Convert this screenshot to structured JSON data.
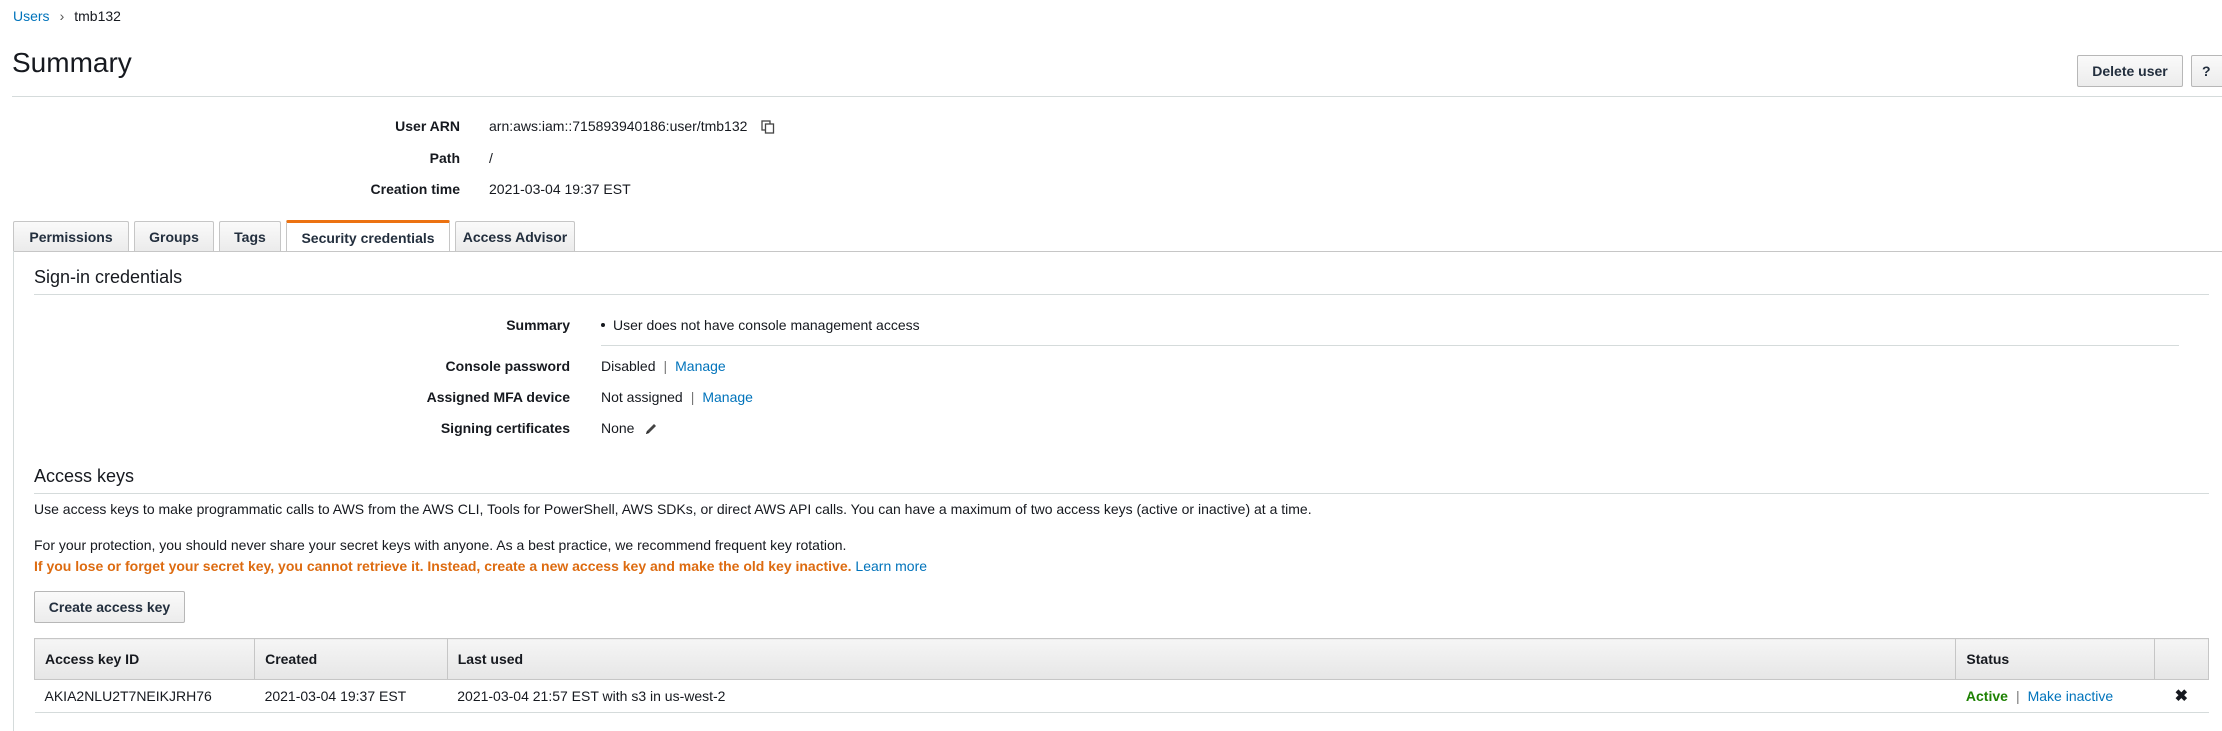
{
  "breadcrumb": {
    "root": "Users",
    "current": "tmb132"
  },
  "header": {
    "title": "Summary",
    "delete_label": "Delete user",
    "help_label": "?"
  },
  "summary": {
    "arn_label": "User ARN",
    "arn_value": "arn:aws:iam::715893940186:user/tmb132",
    "path_label": "Path",
    "path_value": "/",
    "creation_label": "Creation time",
    "creation_value": "2021-03-04 19:37 EST"
  },
  "tabs": [
    {
      "label": "Permissions",
      "active": false
    },
    {
      "label": "Groups",
      "active": false
    },
    {
      "label": "Tags",
      "active": false
    },
    {
      "label": "Security credentials",
      "active": true
    },
    {
      "label": "Access Advisor",
      "active": false
    }
  ],
  "signin": {
    "title": "Sign-in credentials",
    "summary_label": "Summary",
    "summary_value": "User does not have console management access",
    "console_label": "Console password",
    "console_value": "Disabled",
    "console_link": "Manage",
    "mfa_label": "Assigned MFA device",
    "mfa_value": "Not assigned",
    "mfa_link": "Manage",
    "certs_label": "Signing certificates",
    "certs_value": "None"
  },
  "access_keys": {
    "title": "Access keys",
    "desc": "Use access keys to make programmatic calls to AWS from the AWS CLI, Tools for PowerShell, AWS SDKs, or direct AWS API calls. You can have a maximum of two access keys (active or inactive) at a time.",
    "protection": "For your protection, you should never share your secret keys with anyone. As a best practice, we recommend frequent key rotation.",
    "warning": "If you lose or forget your secret key, you cannot retrieve it. Instead, create a new access key and make the old key inactive.",
    "learn_more": "Learn more",
    "create_label": "Create access key",
    "columns": {
      "id": "Access key ID",
      "created": "Created",
      "last_used": "Last used",
      "status": "Status"
    },
    "rows": [
      {
        "id": "AKIA2NLU2T7NEIKJRH76",
        "created": "2021-03-04 19:37 EST",
        "last_used": "2021-03-04 21:57 EST with s3 in us-west-2",
        "status": "Active",
        "action": "Make inactive",
        "remove": "✖"
      }
    ]
  }
}
